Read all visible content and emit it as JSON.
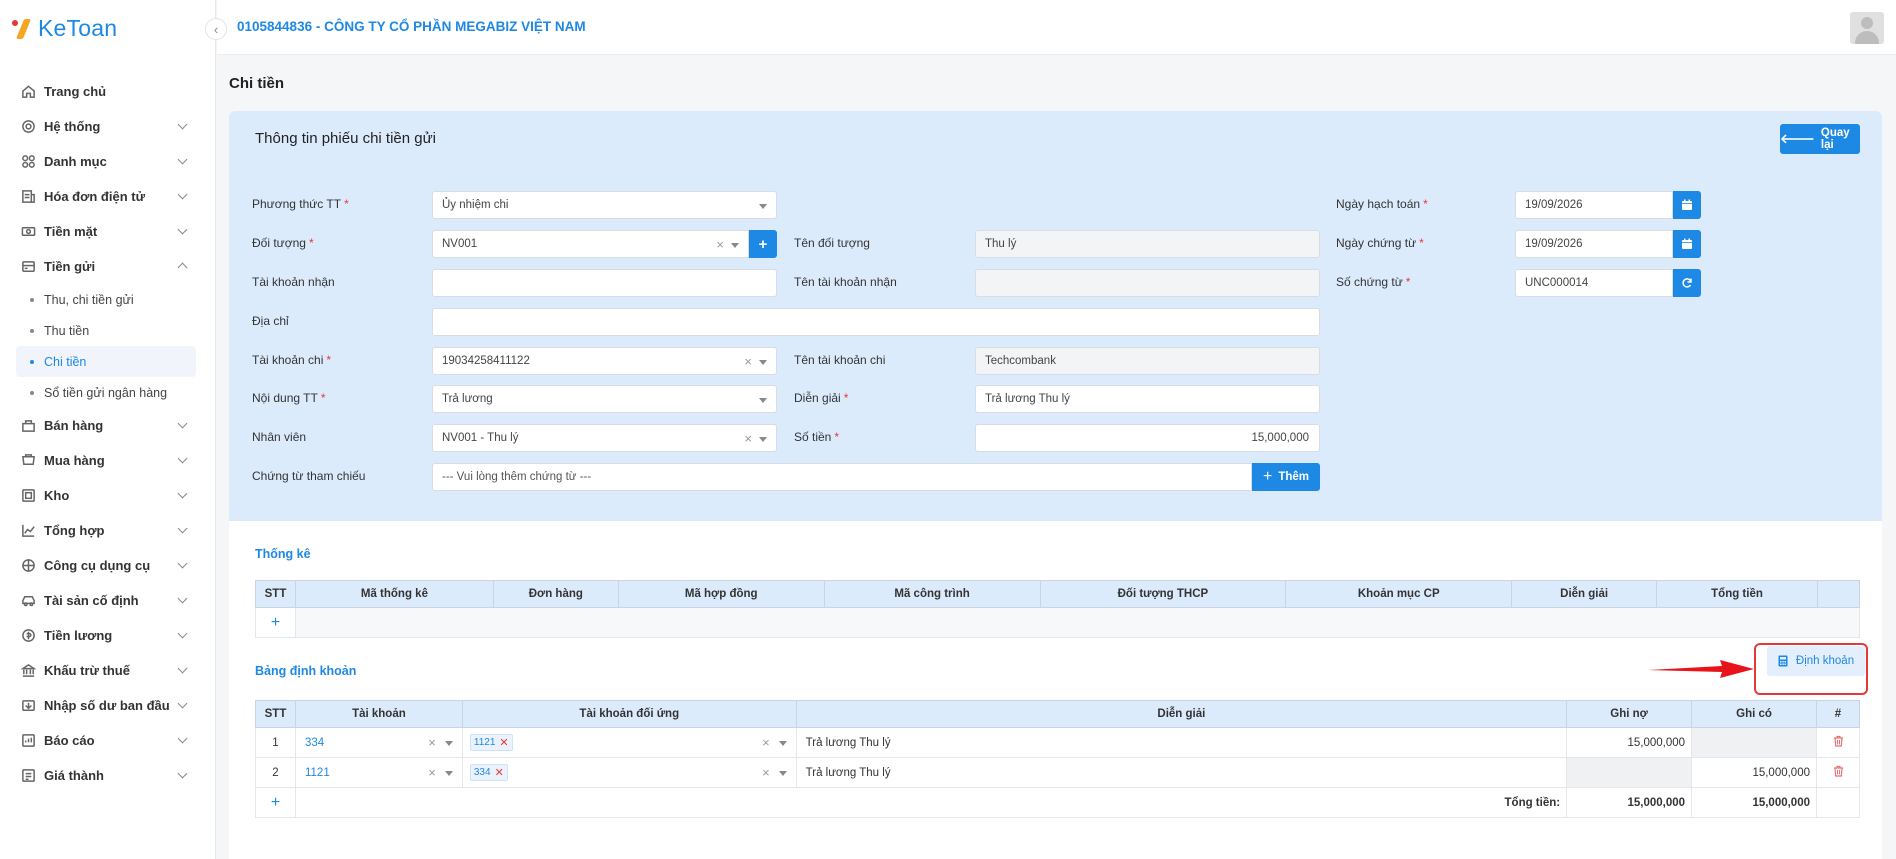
{
  "brand": {
    "name": "KeToan"
  },
  "header": {
    "company": "0105844836 - CÔNG TY CỔ PHẦN MEGABIZ VIỆT NAM"
  },
  "sidebar": {
    "items": [
      {
        "label": "Trang chủ",
        "icon": "home-icon",
        "expandable": false
      },
      {
        "label": "Hệ thống",
        "icon": "gear-icon",
        "expandable": true
      },
      {
        "label": "Danh mục",
        "icon": "grid-icon",
        "expandable": true
      },
      {
        "label": "Hóa đơn điện tử",
        "icon": "invoice-icon",
        "expandable": true
      },
      {
        "label": "Tiền mặt",
        "icon": "cash-icon",
        "expandable": true
      },
      {
        "label": "Tiền gửi",
        "icon": "deposit-icon",
        "expandable": true,
        "expanded": true
      }
    ],
    "submenu": [
      {
        "label": "Thu, chi tiền gửi"
      },
      {
        "label": "Thu tiền"
      },
      {
        "label": "Chi tiền",
        "active": true
      },
      {
        "label": "Sổ tiền gửi ngân hàng"
      }
    ],
    "items_after": [
      {
        "label": "Bán hàng",
        "icon": "sales-icon"
      },
      {
        "label": "Mua hàng",
        "icon": "cart-icon"
      },
      {
        "label": "Kho",
        "icon": "warehouse-icon"
      },
      {
        "label": "Tổng hợp",
        "icon": "chart-icon"
      },
      {
        "label": "Công cụ dụng cụ",
        "icon": "tools-icon"
      },
      {
        "label": "Tài sản cố định",
        "icon": "car-icon"
      },
      {
        "label": "Tiền lương",
        "icon": "salary-icon"
      },
      {
        "label": "Khấu trừ thuế",
        "icon": "bank-icon"
      },
      {
        "label": "Nhập số dư ban đầu",
        "icon": "import-icon"
      },
      {
        "label": "Báo cáo",
        "icon": "report-icon"
      },
      {
        "label": "Giá thành",
        "icon": "price-icon"
      }
    ]
  },
  "page": {
    "title": "Chi tiền"
  },
  "form": {
    "card_title": "Thông tin phiếu chi tiền gửi",
    "back_label": "Quay lại",
    "phuong_thuc": {
      "label": "Phương thức TT",
      "value": "Ủy nhiệm chi"
    },
    "doi_tuong": {
      "label": "Đối tượng",
      "value": "NV001"
    },
    "ten_doi_tuong": {
      "label": "Tên đối tượng",
      "value": "Thu lý"
    },
    "tk_nhan": {
      "label": "Tài khoản nhận",
      "value": ""
    },
    "ten_tk_nhan": {
      "label": "Tên tài khoản nhận",
      "value": ""
    },
    "dia_chi": {
      "label": "Địa chỉ",
      "value": ""
    },
    "tk_chi": {
      "label": "Tài khoản chi",
      "value": "19034258411122"
    },
    "ten_tk_chi": {
      "label": "Tên tài khoản chi",
      "value": "Techcombank"
    },
    "noi_dung": {
      "label": "Nội dung TT",
      "value": "Trả lương"
    },
    "dien_giai": {
      "label": "Diễn giải",
      "value": "Trả lương Thu lý"
    },
    "nhan_vien": {
      "label": "Nhân viên",
      "value": "NV001 - Thu lý"
    },
    "so_tien": {
      "label": "Số tiền",
      "value": "15,000,000"
    },
    "chung_tu": {
      "label": "Chứng từ tham chiếu",
      "placeholder": "--- Vui lòng thêm chứng từ ---",
      "button": "Thêm"
    },
    "ngay_hach_toan": {
      "label": "Ngày hạch toán",
      "value": "19/09/2026"
    },
    "ngay_chung_tu": {
      "label": "Ngày chứng từ",
      "value": "19/09/2026"
    },
    "so_chung_tu": {
      "label": "Số chứng từ",
      "value": "UNC000014"
    }
  },
  "thong_ke": {
    "title": "Thống kê",
    "columns": [
      "STT",
      "Mã thống kê",
      "Đơn hàng",
      "Mã hợp đồng",
      "Mã công trình",
      "Đối tượng THCP",
      "Khoản mục CP",
      "Diễn giải",
      "Tổng tiền"
    ]
  },
  "dinh_khoan": {
    "title": "Bảng định khoản",
    "button": "Định khoản",
    "columns": [
      "STT",
      "Tài khoản",
      "Tài khoản đối ứng",
      "Diễn giải",
      "Ghi nợ",
      "Ghi có",
      "#"
    ],
    "rows": [
      {
        "stt": "1",
        "tk": "334",
        "tk_doi_ung": "1121",
        "dien_giai": "Trả lương Thu lý",
        "ghi_no": "15,000,000",
        "ghi_co": ""
      },
      {
        "stt": "2",
        "tk": "1121",
        "tk_doi_ung": "334",
        "dien_giai": "Trả lương Thu lý",
        "ghi_no": "",
        "ghi_co": "15,000,000"
      }
    ],
    "total_label": "Tổng tiền:",
    "total_no": "15,000,000",
    "total_co": "15,000,000"
  },
  "colors": {
    "accent": "#1e88e5",
    "header_bg": "#dcebfc",
    "danger": "#e53935"
  }
}
